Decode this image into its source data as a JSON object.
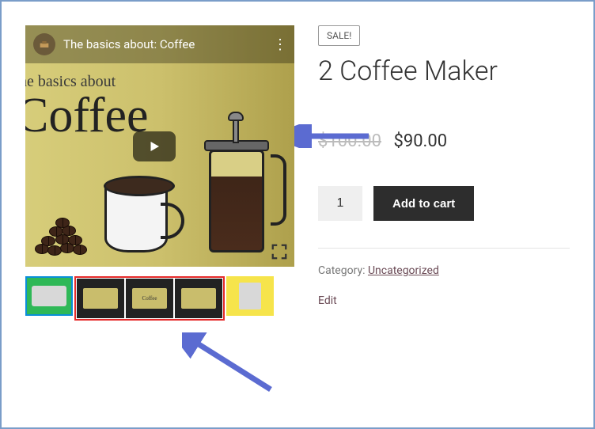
{
  "video": {
    "topbar_title": "The basics about: Coffee",
    "bg_line1": "he basics about",
    "bg_line2": "offee"
  },
  "thumbs": [
    "",
    "",
    "Coffee",
    "",
    ""
  ],
  "product": {
    "sale_badge": "SALE!",
    "title": "2 Coffee Maker",
    "price_old": "$100.00",
    "price_new": "$90.00",
    "quantity": "1",
    "add_to_cart": "Add to cart",
    "category_label": "Category: ",
    "category_value": "Uncategorized",
    "edit": "Edit"
  }
}
